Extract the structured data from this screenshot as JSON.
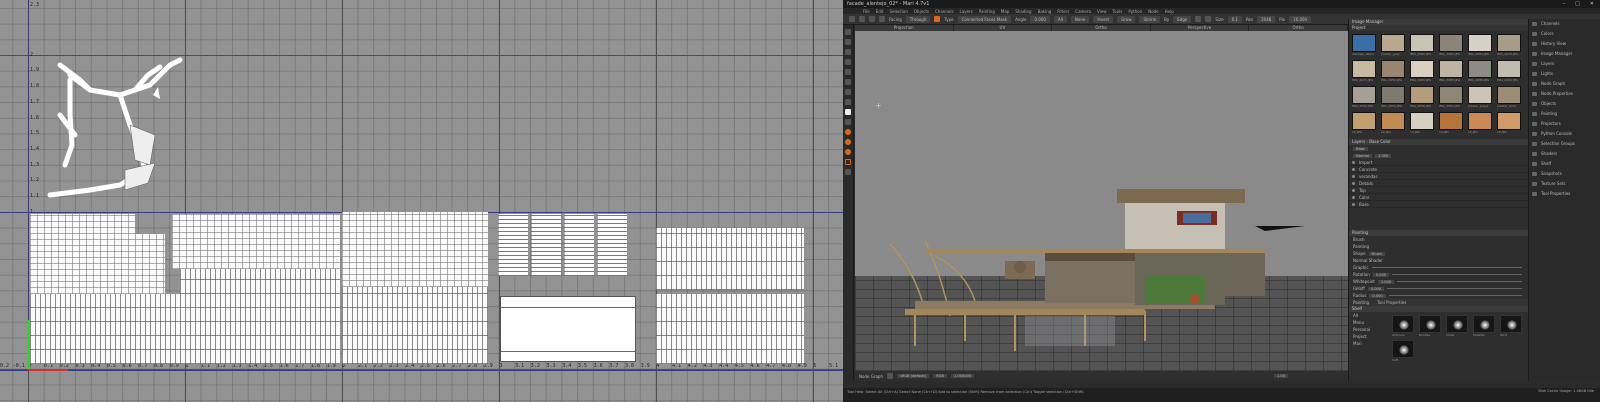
{
  "uv_editor": {
    "axis_y": [
      "2.3",
      "2",
      "1.9",
      "1.8",
      "1.7",
      "1.6",
      "1.5",
      "1.4",
      "1.3",
      "1.2",
      "1.1",
      "1",
      "0.9",
      "0.8",
      "0.7",
      "0.6",
      "0.5",
      "0.4",
      "0.3",
      "0.2"
    ],
    "axis_x": [
      "-0.2",
      "-0.1",
      "0",
      "0.1",
      "0.2",
      "0.3",
      "0.4",
      "0.5",
      "0.6",
      "0.7",
      "0.8",
      "0.9",
      "1",
      "1.1",
      "1.2",
      "1.3",
      "1.4",
      "1.5",
      "1.6",
      "1.7",
      "1.8",
      "1.9",
      "2",
      "2.1",
      "2.2",
      "2.3",
      "2.4",
      "2.5",
      "2.6",
      "2.7",
      "2.8",
      "2.9",
      "3",
      "3.1",
      "3.2",
      "3.3",
      "3.4",
      "3.5",
      "3.6",
      "3.7",
      "3.8",
      "3.9",
      "4",
      "4.1",
      "4.2",
      "4.3",
      "4.4",
      "4.5",
      "4.6",
      "4.7",
      "4.8",
      "4.9",
      "5",
      "5.1",
      "5.2"
    ]
  },
  "app": {
    "title": "facade_alentejo_02* - Mari 4.7v1",
    "menu": [
      "File",
      "Edit",
      "Selection",
      "Objects",
      "Channels",
      "Layers",
      "Painting",
      "Map",
      "Shading",
      "Baking",
      "Filters",
      "Camera",
      "View",
      "Tools",
      "Python",
      "Node",
      "Help"
    ],
    "toolbar": {
      "facing": "Facing",
      "through": "Through",
      "type_label": "Type",
      "type_value": "Connected Faces Mask",
      "angle_label": "Angle",
      "angle_value": "0.000",
      "all": "All",
      "none": "None",
      "invert": "Invert",
      "grow": "Grow",
      "shrink": "Shrink",
      "by_label": "By",
      "by_value": "Edge",
      "size_label": "Size",
      "size_value": "0.1",
      "res_label": "Res",
      "res_value": "2048",
      "pix_label": "Pix",
      "pix_value": "16.000"
    },
    "viewport_tabs": [
      "Projection",
      "UV",
      "Ortho",
      "Perspective",
      "Ortho"
    ],
    "viewport_footer": {
      "label": "Node Graph",
      "colorspace": "sRGB (default)",
      "mode": "RGB",
      "exposure": "1.000000",
      "gain": "1.00"
    },
    "image_manager": {
      "title": "Image Manager",
      "tab": "Project",
      "images": [
        "alentejo_fabric",
        "plaster_grey",
        "IMG_2061.JPG",
        "IMG_2062.JPG",
        "IMG_2063.JPG",
        "IMG_2070.JPG",
        "IMG_2071.JPG",
        "IMG_2059.JPG",
        "IMG_2080.JPG",
        "IMG_2083.JPG",
        "IMG_2086.JPG",
        "IMG_2090.JPG",
        "IMG_2050.JPG",
        "IMG_2054.JPG",
        "IMG_2056.JPG",
        "IMG_2064.JPG",
        "plaster_grey2",
        "plaster_brick",
        "11.JPG",
        "12.JPG",
        "13.JPG",
        "14.JPG",
        "15.JPG",
        "16.JPG"
      ]
    },
    "layers": {
      "title": "Layers - Base Color",
      "channel": "Base",
      "blend": "Normal",
      "opacity": "1.000",
      "items": [
        "Import",
        "Concrete",
        "verandas",
        "Details",
        "Top",
        "Color",
        "Base"
      ]
    },
    "painting": {
      "title": "Painting",
      "section1": "Brush",
      "section2": "Painting",
      "shape_label": "Shape",
      "shape_value": "Brush",
      "section3": "Normal Shader",
      "graph_label": "Graphic",
      "rows": [
        {
          "label": "Rotation",
          "value": "0.000"
        },
        {
          "label": "Whitepoint",
          "value": "1.000"
        },
        {
          "label": "Falloff",
          "value": "0.000"
        },
        {
          "label": "Radius",
          "value": "0.000"
        }
      ],
      "tabs": [
        "Painting",
        "Tool Properties"
      ],
      "shelf_title": "Shelf",
      "shelf_items": [
        "All",
        "Menu",
        "Personal",
        "Project",
        "Mari"
      ],
      "brushes": [
        "Airbrush",
        "Bristles",
        "Chalk",
        "Splatter",
        "Hard",
        "Soft"
      ]
    },
    "right_dock": [
      "Channels",
      "Colors",
      "History View",
      "Image Manager",
      "Layers",
      "Lights",
      "Node Graph",
      "Node Properties",
      "Objects",
      "Painting",
      "Projectors",
      "Python Console",
      "Selection Groups",
      "Shaders",
      "Shelf",
      "Snapshots",
      "Texture Sets",
      "Tool Properties"
    ],
    "status": {
      "line1": "Tool Help: Select All (Ctrl+A)  Select None (Ctrl+D)  Add to selection (Shift)  Remove from selection (Ctrl)  Toggle selection (Ctrl+Shift)",
      "right": "Disk Cache Usage: 1.48GB  Idle"
    }
  }
}
